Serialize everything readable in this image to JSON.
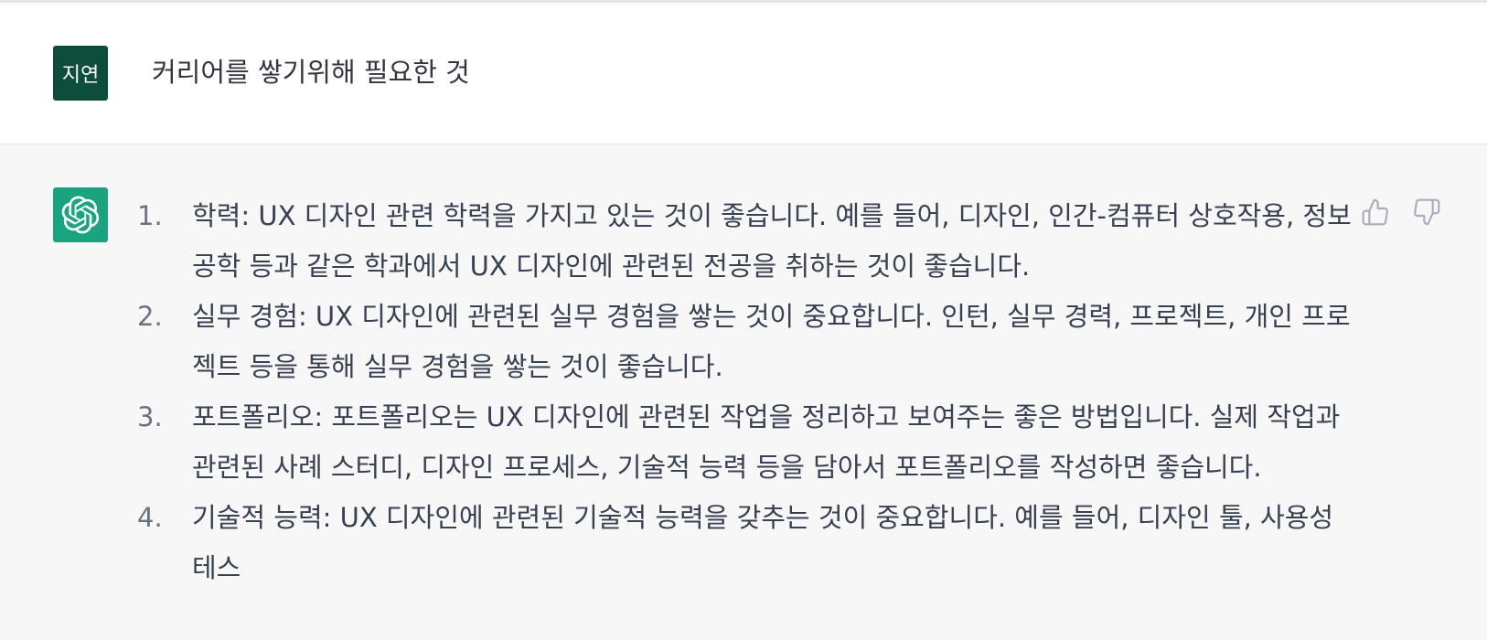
{
  "user_message": {
    "avatar_text": "지연",
    "text": "커리어를 쌓기위해 필요한 것"
  },
  "assistant_message": {
    "avatar_icon": "openai-logo-icon",
    "items": [
      {
        "num": "1.",
        "text": "학력: UX 디자인 관련 학력을 가지고 있는 것이 좋습니다. 예를 들어, 디자인, 인간-컴퓨터 상호작용, 정보 공학 등과 같은 학과에서 UX 디자인에 관련된 전공을 취하는 것이 좋습니다."
      },
      {
        "num": "2.",
        "text": "실무 경험: UX 디자인에 관련된 실무 경험을 쌓는 것이 중요합니다. 인턴, 실무 경력, 프로젝트, 개인 프로젝트 등을 통해 실무 경험을 쌓는 것이 좋습니다."
      },
      {
        "num": "3.",
        "text": "포트폴리오: 포트폴리오는 UX 디자인에 관련된 작업을 정리하고 보여주는 좋은 방법입니다. 실제 작업과 관련된 사례 스터디, 디자인 프로세스, 기술적 능력 등을 담아서 포트폴리오를 작성하면 좋습니다."
      },
      {
        "num": "4.",
        "text": "기술적 능력: UX 디자인에 관련된 기술적 능력을 갖추는 것이 중요합니다. 예를 들어, 디자인 툴, 사용성 테스"
      }
    ],
    "feedback": {
      "thumbs_up_icon": "thumbs-up-icon",
      "thumbs_down_icon": "thumbs-down-icon"
    }
  },
  "colors": {
    "user_avatar_bg": "#0e4d3c",
    "gpt_avatar_bg": "#19a37f",
    "assistant_bg": "#f7f7f8"
  }
}
